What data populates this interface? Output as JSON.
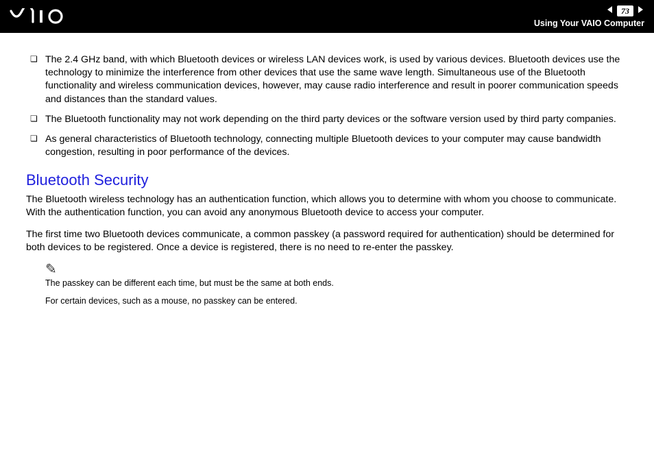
{
  "header": {
    "page_number": "73",
    "section": "Using Your VAIO Computer"
  },
  "bullets": [
    "The 2.4 GHz band, with which Bluetooth devices or wireless LAN devices work, is used by various devices. Bluetooth devices use the technology to minimize the interference from other devices that use the same wave length. Simultaneous use of the Bluetooth functionality and wireless communication devices, however, may cause radio interference and result in poorer communication speeds and distances than the standard values.",
    "The Bluetooth functionality may not work depending on the third party devices or the software version used by third party companies.",
    "As general characteristics of Bluetooth technology, connecting multiple Bluetooth devices to your computer may cause bandwidth congestion, resulting in poor performance of the devices."
  ],
  "section_heading": "Bluetooth Security",
  "paragraphs": [
    "The Bluetooth wireless technology has an authentication function, which allows you to determine with whom you choose to communicate. With the authentication function, you can avoid any anonymous Bluetooth device to access your computer.",
    "The first time two Bluetooth devices communicate, a common passkey (a password required for authentication) should be determined for both devices to be registered. Once a device is registered, there is no need to re-enter the passkey."
  ],
  "note": {
    "line1": "The passkey can be different each time, but must be the same at both ends.",
    "line2": "For certain devices, such as a mouse, no passkey can be entered."
  }
}
